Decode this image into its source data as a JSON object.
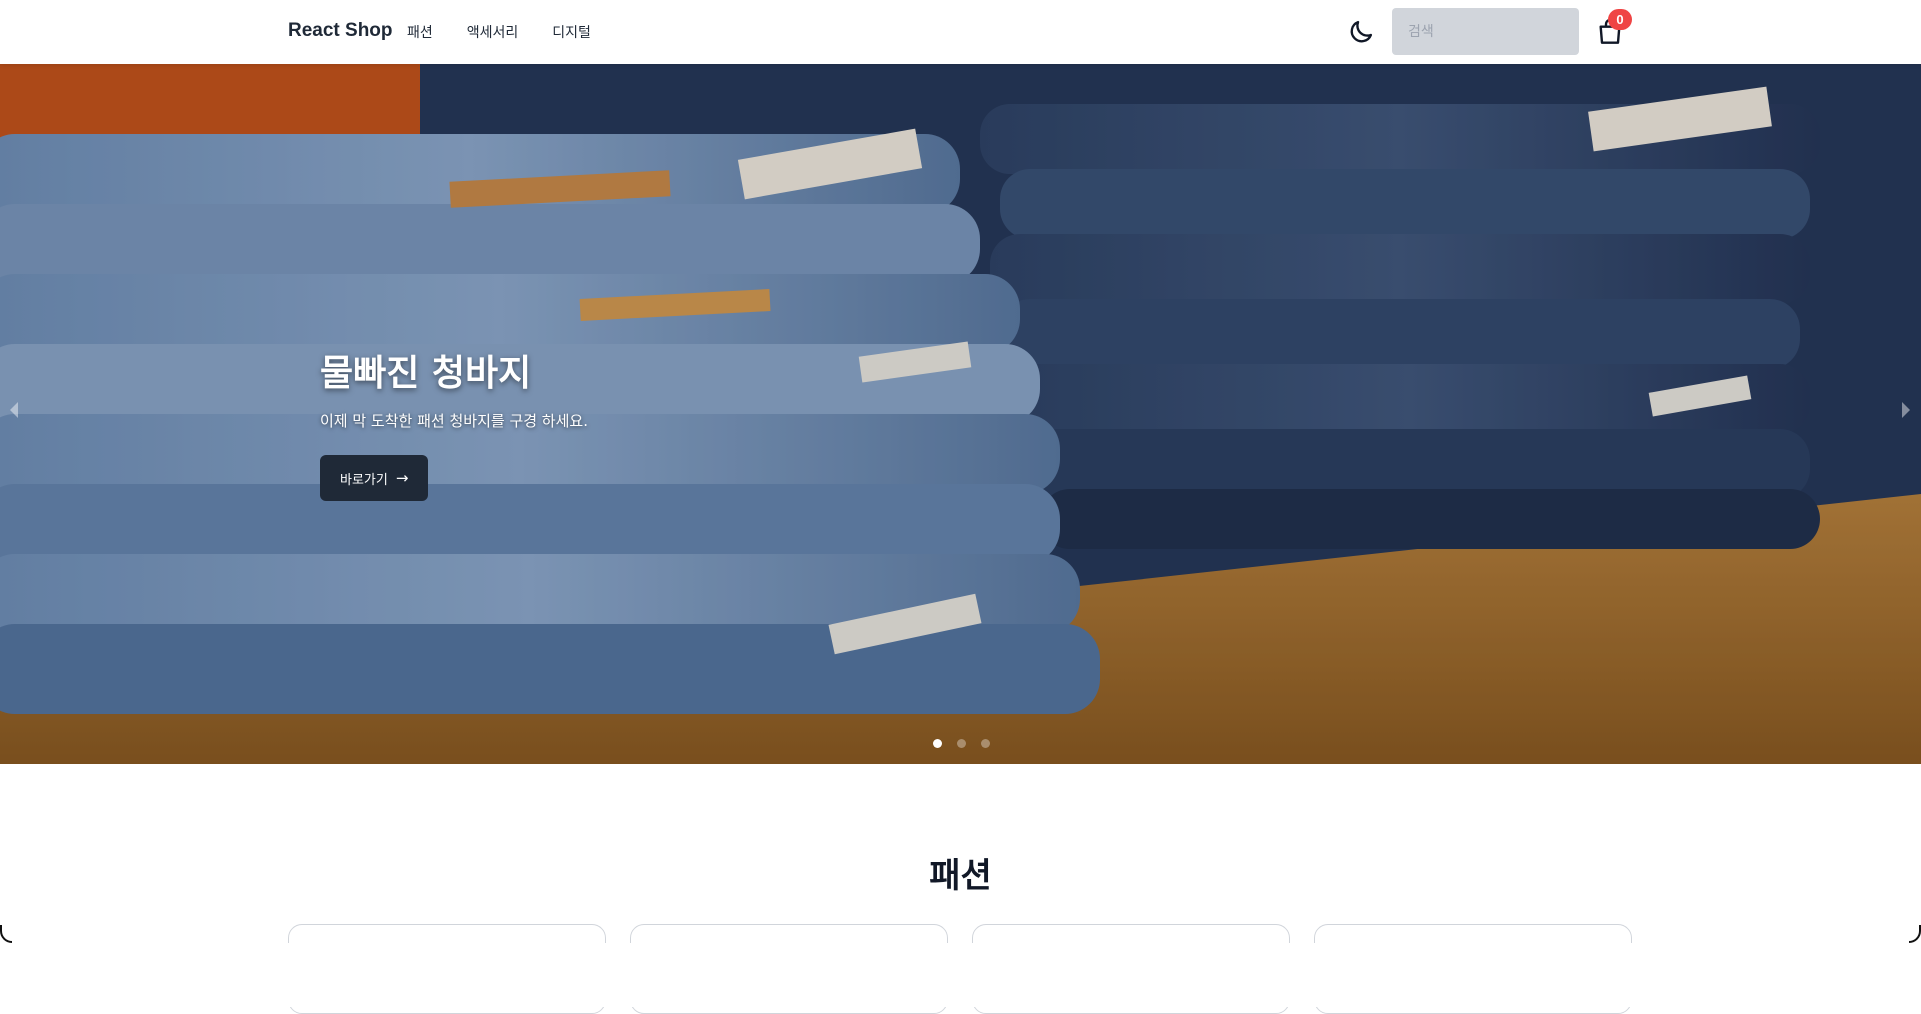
{
  "navbar": {
    "brand": "React Shop",
    "links": [
      {
        "label": "패션"
      },
      {
        "label": "액세서리"
      },
      {
        "label": "디지털"
      }
    ],
    "search": {
      "placeholder": "검색",
      "value": ""
    },
    "cart": {
      "count": "0"
    },
    "icons": {
      "theme": "moon-icon",
      "cart": "shopping-bag-icon"
    }
  },
  "hero": {
    "title": "물빠진 청바지",
    "subtitle": "이제 막 도착한 패션 청바지를 구경 하세요.",
    "button_label": "바로가기",
    "button_icon": "arrow-right-icon",
    "slides_total": 3,
    "active_slide": 1
  },
  "section": {
    "title": "패션"
  },
  "colors": {
    "accent": "#1f2937",
    "badge": "#ef4444",
    "search_bg": "#d1d5db"
  }
}
